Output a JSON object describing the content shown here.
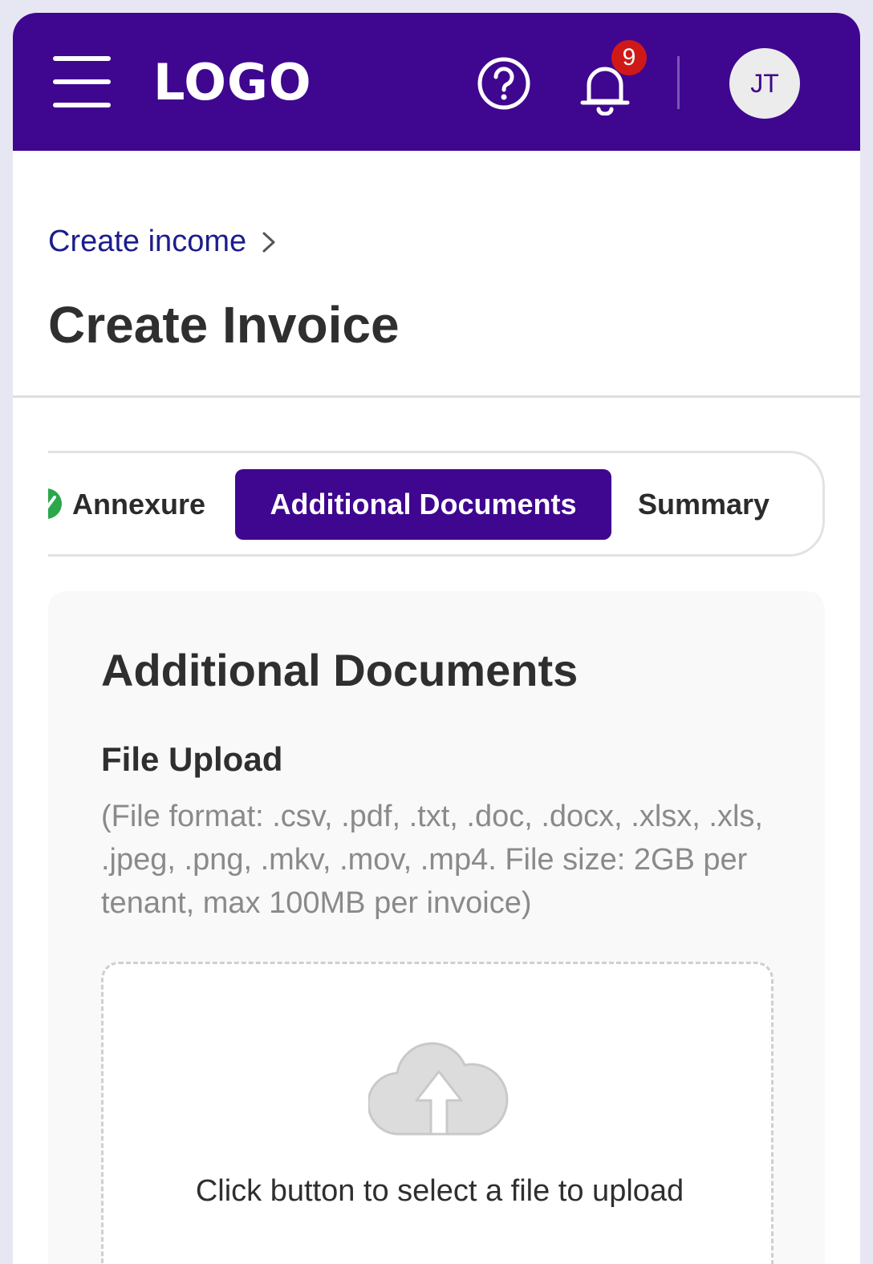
{
  "header": {
    "logo": "LOGO",
    "notification_count": "9",
    "avatar_initials": "JT",
    "brand_color": "#3f078f",
    "icons": [
      "menu-icon",
      "help-icon",
      "bell-icon"
    ]
  },
  "breadcrumb": {
    "parent": "Create income"
  },
  "page": {
    "title": "Create Invoice"
  },
  "stepper": {
    "steps": [
      {
        "label": "Annexure",
        "state": "completed"
      },
      {
        "label": "Additional Documents",
        "state": "active"
      },
      {
        "label": "Summary",
        "state": "pending"
      }
    ]
  },
  "section": {
    "title": "Additional Documents",
    "upload_title": "File Upload",
    "upload_hint": "(File format:  .csv, .pdf, .txt, .doc, .docx, .xlsx, .xls, .jpeg, .png, .mkv, .mov, .mp4. File size: 2GB per tenant, max 100MB per invoice)",
    "dropzone_text": "Click button to select a file to upload"
  }
}
